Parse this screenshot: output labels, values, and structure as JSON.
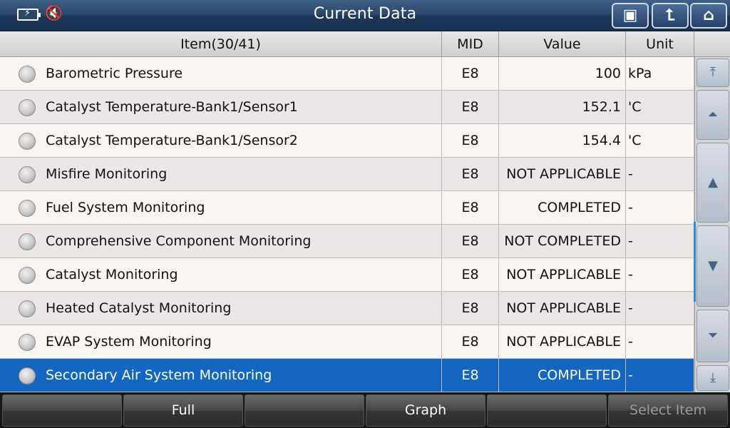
{
  "header": {
    "title": "Current Data",
    "icons": [
      "battery-charging-icon",
      "speaker-muted-icon",
      "screenshot-icon",
      "back-icon",
      "home-icon"
    ]
  },
  "table": {
    "columns": {
      "item": "Item(30/41)",
      "mid": "MID",
      "value": "Value",
      "unit": "Unit"
    },
    "rows": [
      {
        "item": "Barometric Pressure",
        "mid": "E8",
        "value": "100",
        "unit": "kPa"
      },
      {
        "item": "Catalyst Temperature-Bank1/Sensor1",
        "mid": "E8",
        "value": "152.1",
        "unit": "'C"
      },
      {
        "item": "Catalyst Temperature-Bank1/Sensor2",
        "mid": "E8",
        "value": "154.4",
        "unit": "'C"
      },
      {
        "item": "Misfire Monitoring",
        "mid": "E8",
        "value": "NOT APPLICABLE",
        "unit": "-"
      },
      {
        "item": "Fuel System Monitoring",
        "mid": "E8",
        "value": "COMPLETED",
        "unit": "-"
      },
      {
        "item": "Comprehensive Component Monitoring",
        "mid": "E8",
        "value": "NOT COMPLETED",
        "unit": "-"
      },
      {
        "item": "Catalyst Monitoring",
        "mid": "E8",
        "value": "NOT APPLICABLE",
        "unit": "-"
      },
      {
        "item": "Heated Catalyst Monitoring",
        "mid": "E8",
        "value": "NOT APPLICABLE",
        "unit": "-"
      },
      {
        "item": "EVAP System Monitoring",
        "mid": "E8",
        "value": "NOT APPLICABLE",
        "unit": "-"
      },
      {
        "item": "Secondary Air System Monitoring",
        "mid": "E8",
        "value": "COMPLETED",
        "unit": "-"
      }
    ],
    "selected_row_color": "#1566c0"
  },
  "toolbar": {
    "buttons": [
      "",
      "Full",
      "",
      "Graph",
      "",
      "Select Item"
    ]
  }
}
